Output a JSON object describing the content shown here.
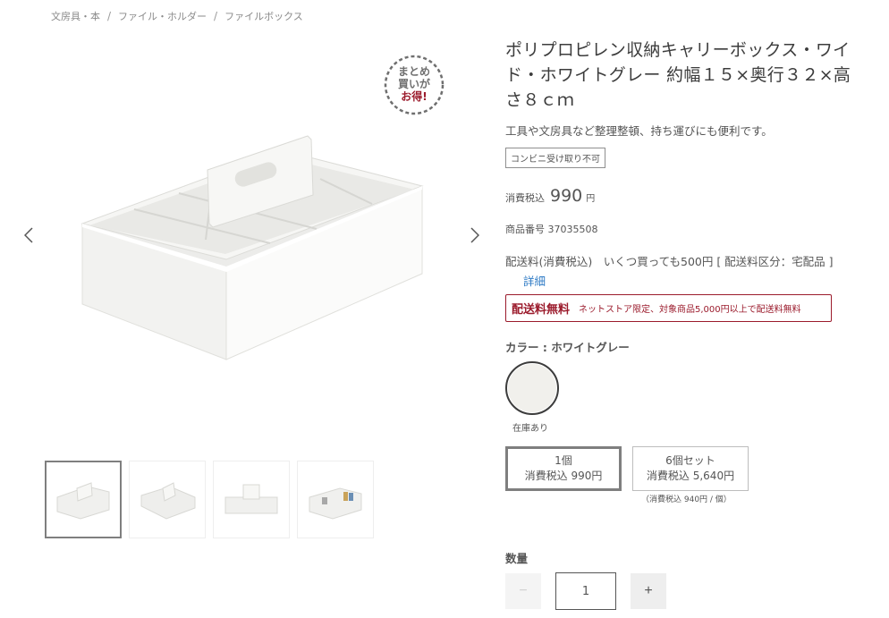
{
  "breadcrumb": {
    "items": [
      "文房具・本",
      "ファイル・ホルダー",
      "ファイルボックス"
    ],
    "separator": "/"
  },
  "gallery": {
    "badge": {
      "line1": "まとめ",
      "line2": "買いが",
      "line3": "お得!"
    },
    "thumbnails_count": 4,
    "active_thumbnail": 1
  },
  "product": {
    "title": "ポリプロピレン収納キャリーボックス・ワイド・ホワイトグレー 約幅１５×奥行３２×高さ８ｃｍ",
    "subtitle": "工具や文房具など整理整頓、持ち運びにも便利です。",
    "tag": "コンビニ受け取り不可",
    "price_label": "消費税込",
    "price": "990",
    "price_unit": "円",
    "code_label": "商品番号",
    "code": "37035508",
    "shipping_text": "配送料(消費税込)　いくつ買っても500円 [ 配送料区分：宅配品 ]",
    "shipping_detail": "詳細",
    "free_ship_strong": "配送料無料",
    "free_ship_note": "ネットストア限定、対象商品5,000円以上で配送料無料",
    "color_label": "カラー : ホワイトグレー",
    "stock": "在庫あり",
    "sets": [
      {
        "line1": "1個",
        "line2": "消費税込 990円"
      },
      {
        "line1": "6個セット",
        "line2": "消費税込 5,640円"
      }
    ],
    "set_note": "（消費税込 940円 / 個）",
    "qty_label": "数量",
    "qty_value": "1",
    "qty_minus": "−",
    "qty_plus": "+"
  },
  "colors": {
    "accent_red": "#9b1b2c",
    "link_blue": "#2f7bc5",
    "swatch": "#f1f0ec"
  }
}
